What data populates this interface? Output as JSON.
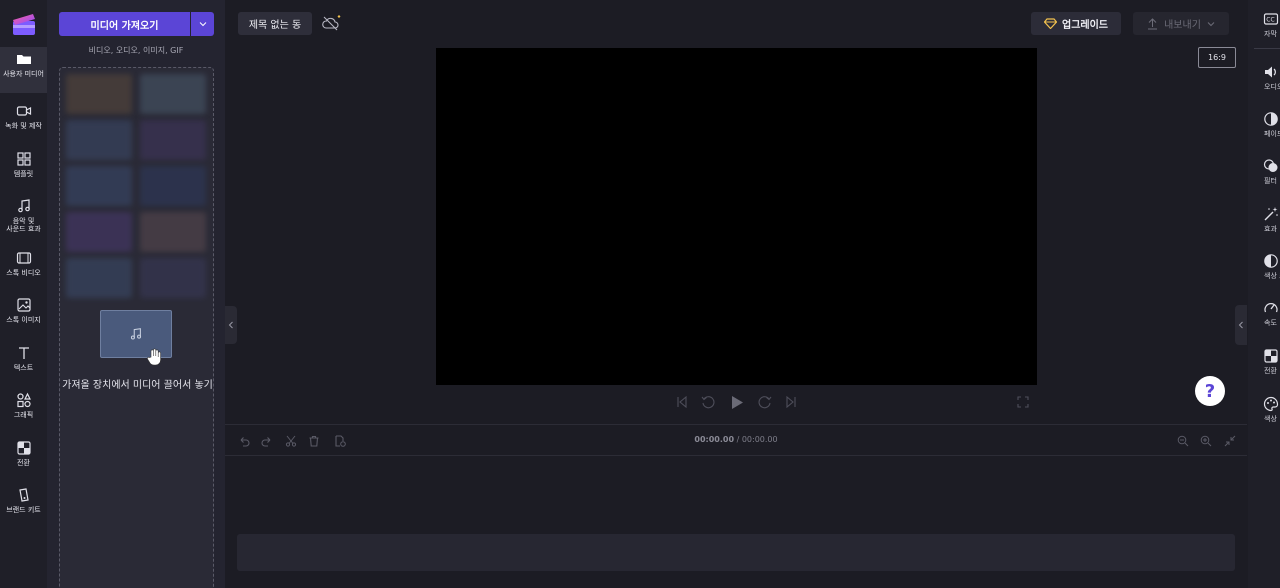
{
  "rail": {
    "items": [
      {
        "label": "사용자 미디어",
        "icon": "folder-icon",
        "active": true
      },
      {
        "label": "녹화 및 제작",
        "icon": "camera-icon"
      },
      {
        "label": "템플릿",
        "icon": "templates-icon"
      },
      {
        "label": "음악 및 사운드 효과",
        "icon": "music-icon"
      },
      {
        "label": "스톡 비디오",
        "icon": "film-icon"
      },
      {
        "label": "스톡 이미지",
        "icon": "image-icon"
      },
      {
        "label": "텍스트",
        "icon": "text-icon"
      },
      {
        "label": "그래픽",
        "icon": "shapes-icon"
      },
      {
        "label": "전환",
        "icon": "transition-icon"
      },
      {
        "label": "브랜드 키트",
        "icon": "brand-kit-icon"
      }
    ]
  },
  "panel": {
    "import_label": "미디어 가져오기",
    "subtitle": "비디오, 오디오, 이미지, GIF",
    "drop_text": "가져올 장치에서 미디어 끌어서 놓기"
  },
  "topbar": {
    "title": "제목 없는 동",
    "upgrade_label": "업그레이드",
    "export_label": "내보내기"
  },
  "preview": {
    "aspect_ratio": "16:9"
  },
  "timeline": {
    "current_time": "00:00.00",
    "separator": " / ",
    "total_time": "00:00.00"
  },
  "right_rail": {
    "items": [
      {
        "label": "자막",
        "icon": "captions-icon"
      },
      {
        "label": "오디오",
        "icon": "audio-icon"
      },
      {
        "label": "페이드",
        "icon": "fade-icon"
      },
      {
        "label": "필터",
        "icon": "filters-icon"
      },
      {
        "label": "효과",
        "icon": "effects-icon"
      },
      {
        "label": "색상 조",
        "icon": "color-adjust-icon"
      },
      {
        "label": "속도",
        "icon": "speed-icon"
      },
      {
        "label": "전환",
        "icon": "transition-icon"
      },
      {
        "label": "색상",
        "icon": "palette-icon"
      }
    ]
  },
  "colors": {
    "accent": "#5b45d6",
    "background": "#1c1c24"
  }
}
